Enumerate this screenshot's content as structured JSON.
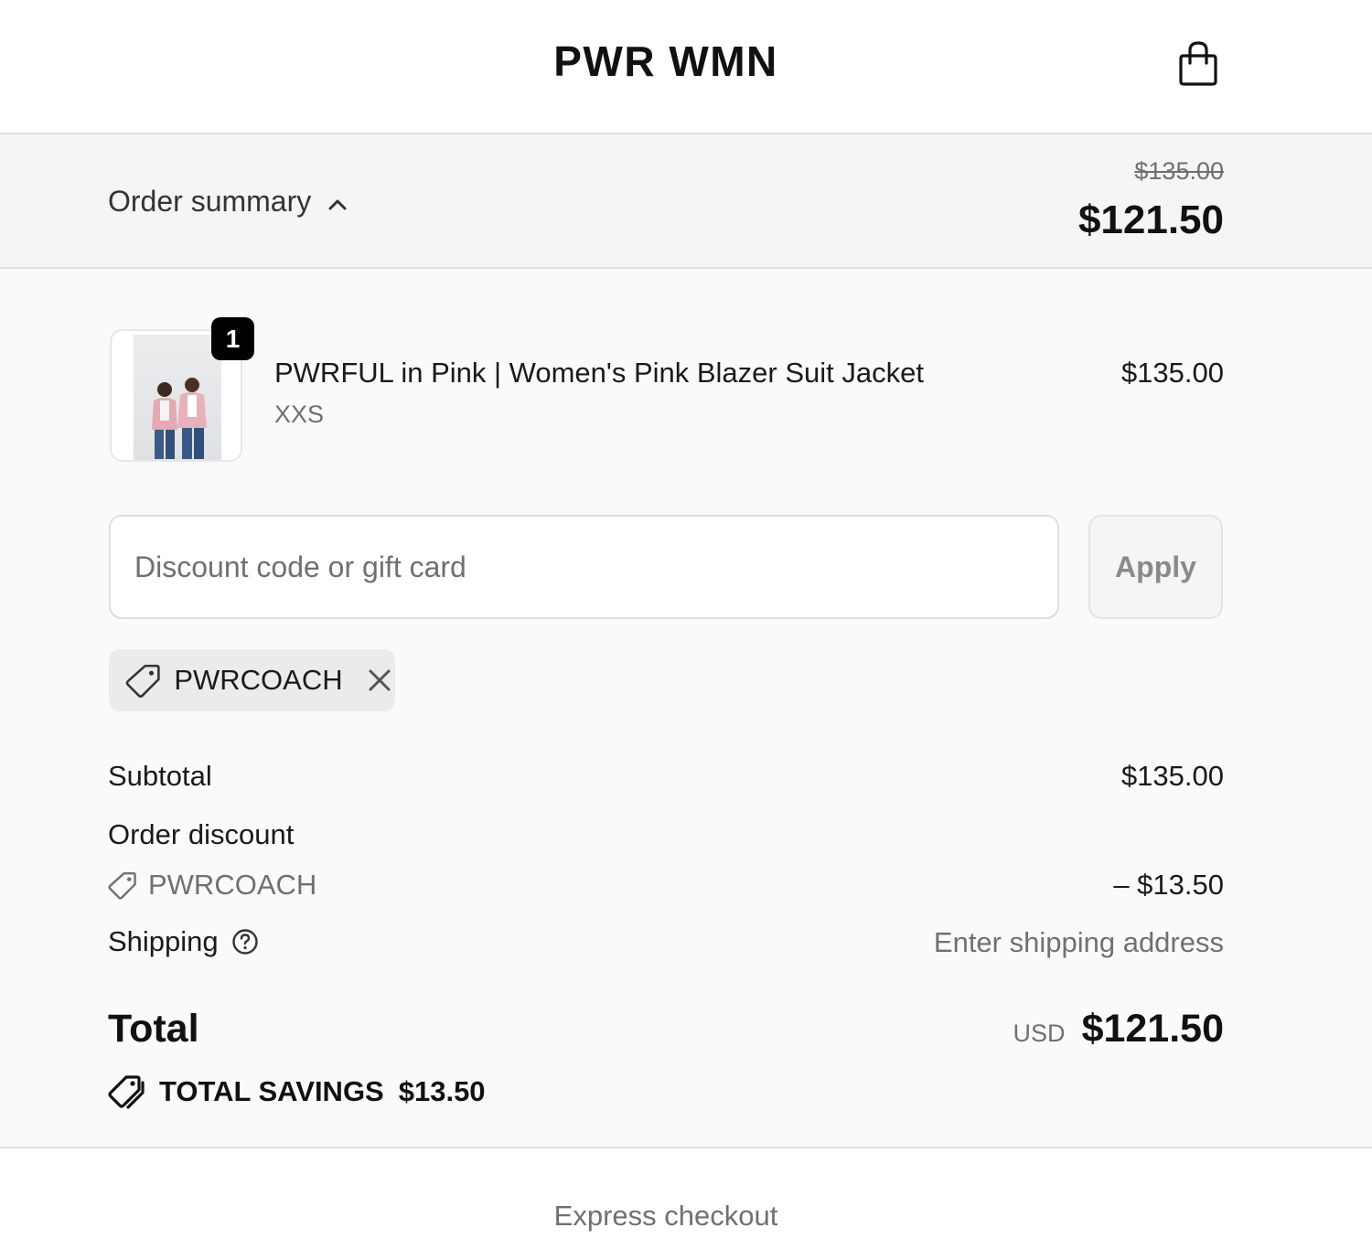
{
  "header": {
    "brand": "PWR WMN",
    "cart_icon": "shopping-bag-icon"
  },
  "summary": {
    "toggle_label": "Order summary",
    "toggle_icon": "chevron-up-icon",
    "original_total": "$135.00",
    "discounted_total": "$121.50"
  },
  "line_items": [
    {
      "name": "PWRFUL in Pink | Women's Pink Blazer Suit Jacket",
      "variant": "XXS",
      "price": "$135.00",
      "quantity": "1"
    }
  ],
  "discount": {
    "placeholder": "Discount code or gift card",
    "value": "",
    "apply_label": "Apply",
    "applied_code": "PWRCOACH"
  },
  "totals": {
    "subtotal_label": "Subtotal",
    "subtotal_value": "$135.00",
    "order_discount_label": "Order discount",
    "order_discount_code": "PWRCOACH",
    "order_discount_value": "– $13.50",
    "shipping_label": "Shipping",
    "shipping_value": "Enter shipping address",
    "total_label": "Total",
    "total_currency": "USD",
    "total_value": "$121.50",
    "savings_label": "TOTAL SAVINGS",
    "savings_value": "$13.50"
  },
  "express": {
    "label": "Express checkout"
  },
  "colors": {
    "summary_bg": "#f5f5f5",
    "body_bg": "#fafafa",
    "border": "#dedede",
    "muted_text": "#707070",
    "badge_bg": "#000000",
    "chip_bg": "#ebebeb"
  }
}
